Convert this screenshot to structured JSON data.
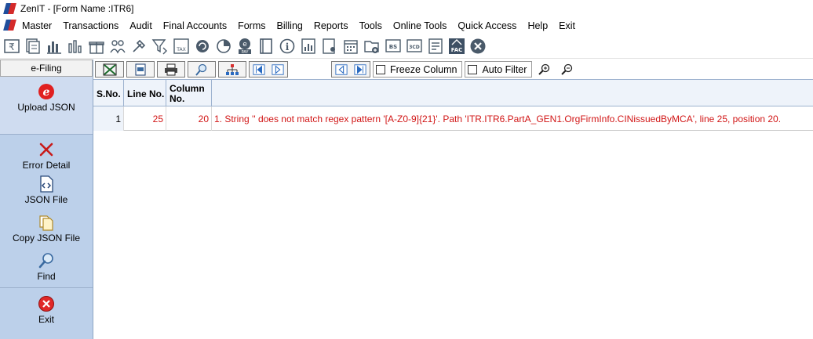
{
  "window": {
    "title": "ZenIT - [Form Name :ITR6]"
  },
  "menu": [
    "Master",
    "Transactions",
    "Audit",
    "Final Accounts",
    "Forms",
    "Billing",
    "Reports",
    "Tools",
    "Online Tools",
    "Quick Access",
    "Help",
    "Exit"
  ],
  "toolbar_icons": [
    "rupee-icon",
    "transactions-icon",
    "chart-icon",
    "bar-chart-icon",
    "gift-icon",
    "users-icon",
    "tools-icon",
    "filter-icon",
    "tax-icon",
    "refresh-icon",
    "pie-chart-icon",
    "epay-icon",
    "book-icon",
    "info-icon",
    "report-icon",
    "user-form-icon",
    "calendar-icon",
    "folder-add-icon",
    "bs-icon",
    "3cd-icon",
    "form-icon",
    "fac-icon",
    "close-icon"
  ],
  "toolbar_labels": {
    "tax": "TAX",
    "pay": "PAY",
    "bs": "BS",
    "cd3": "3CD",
    "fac": "FAC"
  },
  "sidebar": {
    "header": "e-Filing",
    "items": [
      {
        "label": "Upload JSON",
        "icon": "efile-icon"
      },
      {
        "label": "Error Detail",
        "icon": "cross-icon"
      },
      {
        "label": "JSON File",
        "icon": "code-file-icon"
      },
      {
        "label": "Copy JSON File",
        "icon": "copy-icon"
      },
      {
        "label": "Find",
        "icon": "search-icon"
      },
      {
        "label": "Exit",
        "icon": "exit-icon"
      }
    ]
  },
  "gridbar": {
    "freeze_column": "Freeze Column",
    "auto_filter": "Auto Filter"
  },
  "grid": {
    "columns": [
      "S.No.",
      "Line No.",
      "Column No."
    ],
    "rows": [
      {
        "sno": "1",
        "line": "25",
        "column": "20",
        "message": "1. String '' does not match regex pattern '[A-Z0-9]{21}'. Path 'ITR.ITR6.PartA_GEN1.OrgFirmInfo.CINissuedByMCA', line 25, position 20."
      }
    ]
  },
  "colors": {
    "error_text": "#d11515",
    "sidebar_bg": "#bcd0ea",
    "header_bg": "#eef3fa"
  }
}
